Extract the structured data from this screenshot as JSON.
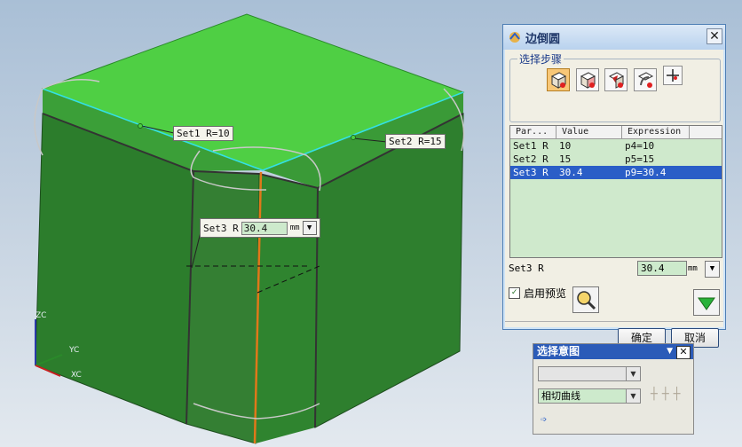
{
  "canvas": {
    "set1_label": "Set1 R=10",
    "set2_label": "Set2 R=15",
    "set3_prefix": "Set3 R",
    "set3_value": "30.4",
    "set3_unit": "mm",
    "axes": {
      "z": "ZC",
      "y": "YC",
      "x": "XC"
    }
  },
  "dialog": {
    "title": "边倒圆",
    "close": "✕",
    "steps_label": "选择步骤",
    "table": {
      "columns": [
        "Par...",
        "Value",
        "Expression"
      ],
      "rows": [
        {
          "param": "Set1 R",
          "value": "10",
          "expr": "p4=10",
          "selected": false
        },
        {
          "param": "Set2 R",
          "value": "15",
          "expr": "p5=15",
          "selected": false
        },
        {
          "param": "Set3 R",
          "value": "30.4",
          "expr": "p9=30.4",
          "selected": true
        }
      ]
    },
    "current_param": "Set3 R",
    "current_value": "30.4",
    "unit": "mm",
    "preview_label": "启用预览",
    "preview_checked": true,
    "ok_label": "确定",
    "cancel_label": "取消"
  },
  "intent": {
    "title": "选择意图",
    "combo1_value": "",
    "combo2_value": "相切曲线"
  },
  "colors": {
    "face_top": "#4fcf44",
    "face_side": "#2a7a2a",
    "selected_edge": "#33e0e6",
    "orange_edge": "#e0781a",
    "selection": "#2a5ec7"
  }
}
